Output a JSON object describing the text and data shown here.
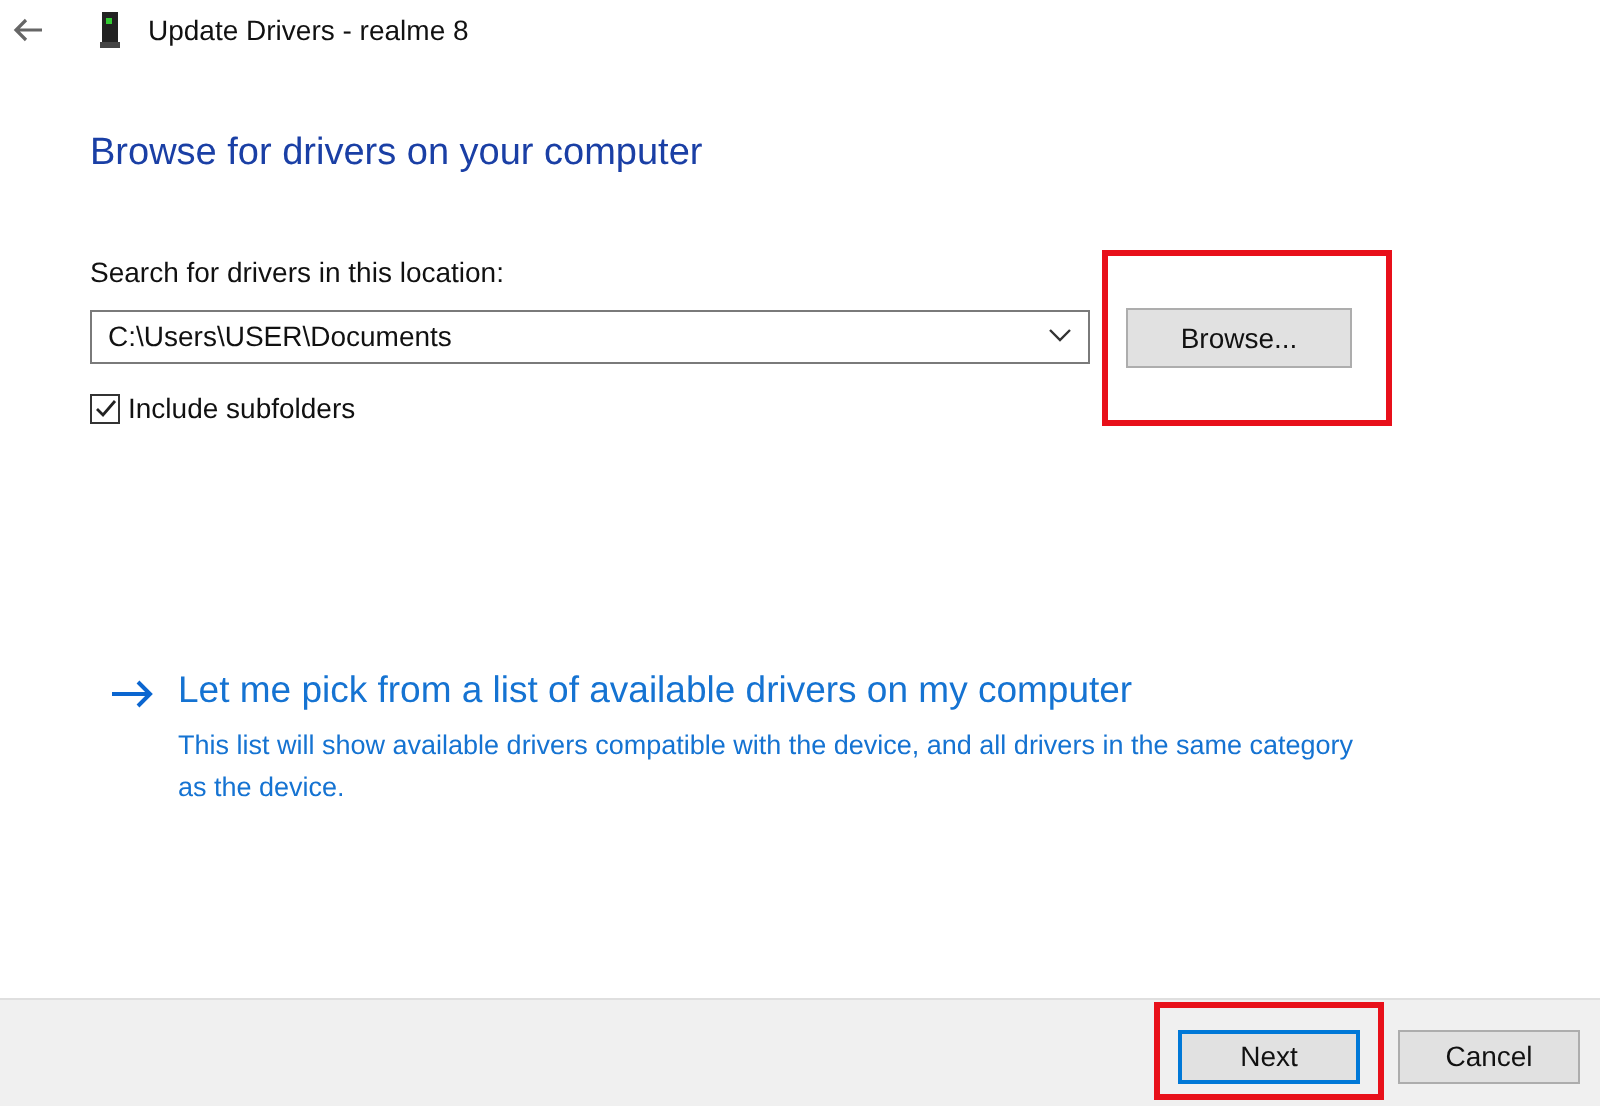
{
  "window": {
    "title": "Update Drivers - realme 8"
  },
  "heading": "Browse for drivers on your computer",
  "location": {
    "label": "Search for drivers in this location:",
    "value": "C:\\Users\\USER\\Documents"
  },
  "browse_button": {
    "label": "Browse...",
    "highlighted": true
  },
  "include_subfolders": {
    "label": "Include subfolders",
    "checked": true
  },
  "pick_link": {
    "title": "Let me pick from a list of available drivers on my computer",
    "description": "This list will show available drivers compatible with the device, and all drivers in the same category as the device."
  },
  "buttons": [
    {
      "label": "Next",
      "default": true,
      "highlighted": true
    },
    {
      "label": "Cancel",
      "default": false,
      "highlighted": false
    }
  ]
}
